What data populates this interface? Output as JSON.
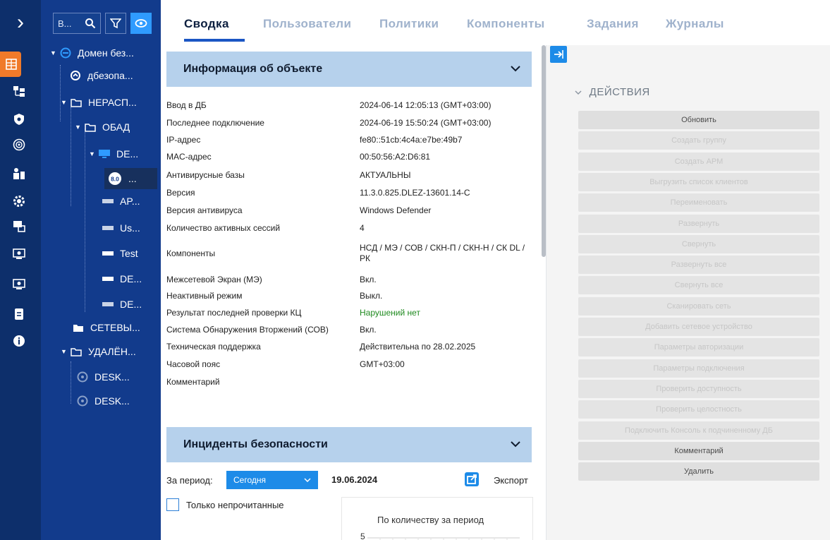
{
  "tree": {
    "search_text": "В...",
    "items": [
      {
        "label": "Домен без...",
        "icon": "domain-icon"
      },
      {
        "label": "дбезопа...",
        "icon": "gear-icon"
      },
      {
        "label": "НЕРАСП...",
        "icon": "folder-icon"
      },
      {
        "label": "ОБАД",
        "icon": "folder-icon"
      },
      {
        "label": "DE...",
        "icon": "monitor-icon"
      },
      {
        "label": "...",
        "icon": "agent-icon"
      },
      {
        "label": "AP...",
        "icon": "computer-icon"
      },
      {
        "label": "Us...",
        "icon": "computer-icon"
      },
      {
        "label": "Test",
        "icon": "computer-icon"
      },
      {
        "label": "DE...",
        "icon": "computer-icon"
      },
      {
        "label": "DE...",
        "icon": "computer-icon"
      },
      {
        "label": "СЕТЕВЫ...",
        "icon": "folder-filled-icon"
      },
      {
        "label": "УДАЛЁН...",
        "icon": "folder-icon"
      },
      {
        "label": "DESK...",
        "icon": "remote-computer-icon"
      },
      {
        "label": "DESK...",
        "icon": "remote-computer-icon"
      }
    ],
    "agent_badge": "8.0"
  },
  "tabs": [
    "Сводка",
    "Пользователи",
    "Политики",
    "Компоненты",
    "Задания",
    "Журналы"
  ],
  "object_info": {
    "title": "Информация об объекте",
    "rows": [
      {
        "k": "Ввод в ДБ",
        "v": "2024-06-14 12:05:13 (GMT+03:00)"
      },
      {
        "k": "Последнее подключение",
        "v": "2024-06-19 15:50:24 (GMT+03:00)"
      },
      {
        "k": "IP-адрес",
        "v": "fe80::51cb:4c4a:e7be:49b7"
      },
      {
        "k": "MAC-адрес",
        "v": "00:50:56:A2:D6:81"
      },
      {
        "k": "Антивирусные базы",
        "v": "АКТУАЛЬНЫ"
      },
      {
        "k": "Версия",
        "v": "11.3.0.825.DLEZ-13601.14-C"
      },
      {
        "k": "Версия антивируса",
        "v": "Windows Defender"
      },
      {
        "k": "Количество активных сессий",
        "v": "4"
      },
      {
        "k": "Компоненты",
        "v": "НСД / МЭ / СОВ / СКН-П / СКН-Н / СК DL / РК"
      },
      {
        "k": "Межсетевой Экран (МЭ)",
        "v": "Вкл."
      },
      {
        "k": "Неактивный режим",
        "v": "Выкл."
      },
      {
        "k": "Результат последней проверки КЦ",
        "v": "Нарушений нет"
      },
      {
        "k": "Система Обнаружения Вторжений (СОВ)",
        "v": "Вкл."
      },
      {
        "k": "Техническая поддержка",
        "v": "Действительна по 28.02.2025"
      },
      {
        "k": "Часовой пояс",
        "v": "GMT+03:00"
      },
      {
        "k": "Комментарий",
        "v": ""
      }
    ]
  },
  "incidents": {
    "title": "Инциденты безопасности",
    "period_label": "За период:",
    "period_value": "Сегодня",
    "date": "19.06.2024",
    "export_label": "Экспорт",
    "unread_only": "Только непрочитанные",
    "chart_title": "По количеству за период",
    "chart_tick": "5"
  },
  "actions": {
    "title": "ДЕЙСТВИЯ",
    "buttons": [
      {
        "label": "Обновить",
        "enabled": true
      },
      {
        "label": "Создать группу",
        "enabled": false
      },
      {
        "label": "Создать АРМ",
        "enabled": false
      },
      {
        "label": "Выгрузить список клиентов",
        "enabled": false
      },
      {
        "label": "Переименовать",
        "enabled": false
      },
      {
        "label": "Развернуть",
        "enabled": false
      },
      {
        "label": "Свернуть",
        "enabled": false
      },
      {
        "label": "Развернуть все",
        "enabled": false
      },
      {
        "label": "Свернуть все",
        "enabled": false
      },
      {
        "label": "Сканировать сеть",
        "enabled": false
      },
      {
        "label": "Добавить сетевое устройство",
        "enabled": false
      },
      {
        "label": "Параметры авторизации",
        "enabled": false
      },
      {
        "label": "Параметры подключения",
        "enabled": false
      },
      {
        "label": "Проверить доступность",
        "enabled": false
      },
      {
        "label": "Проверить целостность",
        "enabled": false
      },
      {
        "label": "Подключить Консоль к подчиненному ДБ",
        "enabled": false
      },
      {
        "label": "Комментарий",
        "enabled": true
      },
      {
        "label": "Удалить",
        "enabled": true
      }
    ]
  },
  "colors": {
    "rail": "#0d2f6b",
    "tree": "#123b8c",
    "accent": "#1d8be8",
    "active_rail": "#f07a2a",
    "ok_green": "#1f8a1f"
  }
}
